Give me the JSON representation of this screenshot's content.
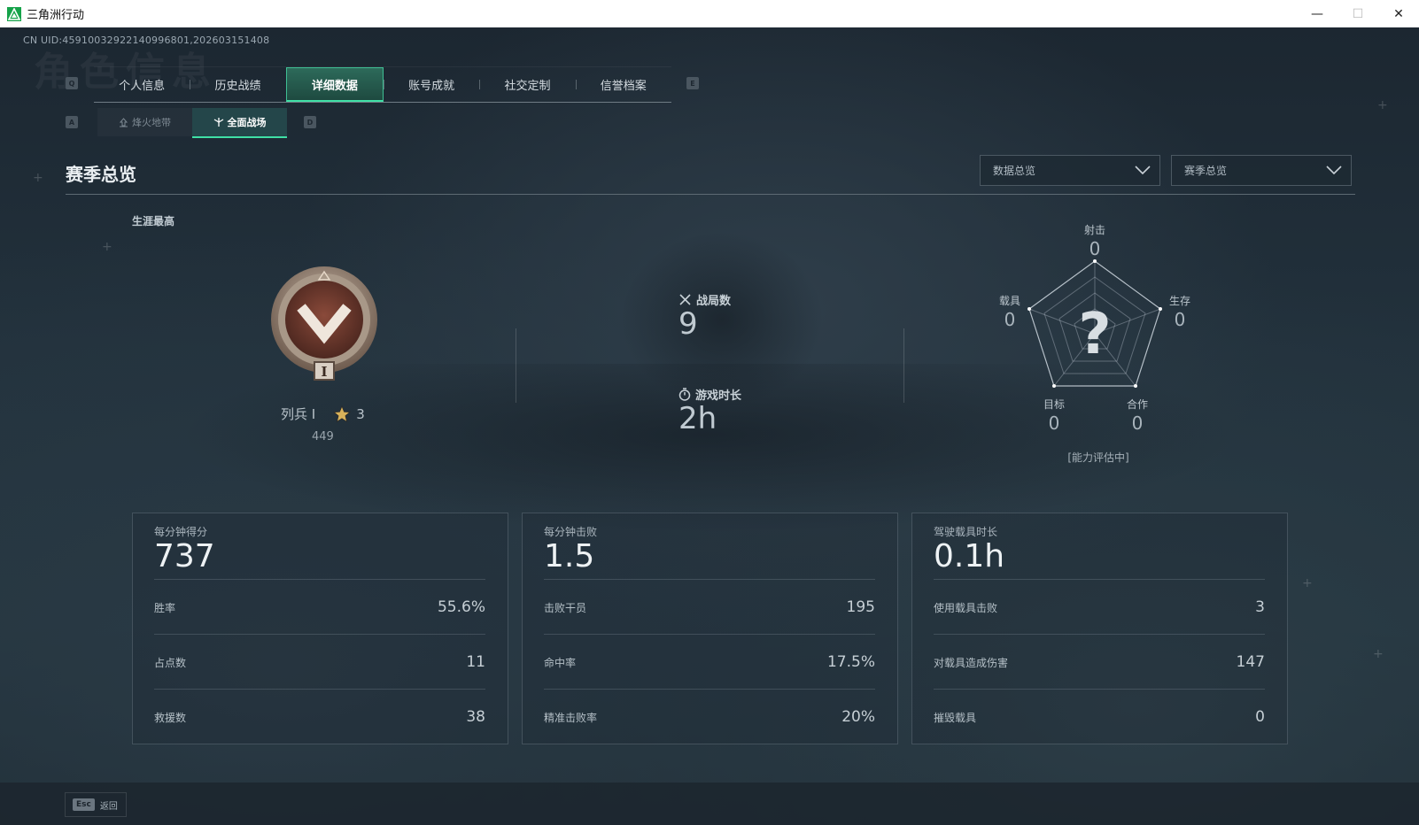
{
  "window": {
    "title": "三角洲行动",
    "minimize": "—",
    "maximize": "☐",
    "close": "✕"
  },
  "uid": "CN UID:4591003292214099680​1,202603151408",
  "watermark": "角色信息",
  "nav": {
    "key_left": "Q",
    "key_right": "E",
    "tabs": [
      "个人信息",
      "历史战绩",
      "详细数据",
      "账号成就",
      "社交定制",
      "信誉档案"
    ],
    "active_index": 2
  },
  "subnav": {
    "key_left": "A",
    "key_right": "D",
    "tabs": [
      "烽火地带",
      "全面战场"
    ],
    "active_index": 1
  },
  "section": {
    "title": "赛季总览",
    "dropdown_1": "数据总览",
    "dropdown_2": "赛季总览"
  },
  "career": {
    "label": "生涯最高",
    "rank_name": "列兵 I",
    "rank_numeral": "I",
    "stars": "3",
    "score": "449"
  },
  "summary": {
    "matches_label": "战局数",
    "matches_value": "9",
    "playtime_label": "游戏时长",
    "playtime_value": "2h"
  },
  "radar": {
    "unknown_mark": "?",
    "status": "[能力评估中]",
    "axes": [
      {
        "label": "射击",
        "value": "0"
      },
      {
        "label": "生存",
        "value": "0"
      },
      {
        "label": "合作",
        "value": "0"
      },
      {
        "label": "目标",
        "value": "0"
      },
      {
        "label": "载具",
        "value": "0"
      }
    ]
  },
  "cards": [
    {
      "head_label": "每分钟得分",
      "head_value": "737",
      "rows": [
        {
          "k": "胜率",
          "v": "55.6%"
        },
        {
          "k": "占点数",
          "v": "11"
        },
        {
          "k": "救援数",
          "v": "38"
        }
      ]
    },
    {
      "head_label": "每分钟击败",
      "head_value": "1.5",
      "rows": [
        {
          "k": "击败干员",
          "v": "195"
        },
        {
          "k": "命中率",
          "v": "17.5%"
        },
        {
          "k": "精准击败率",
          "v": "20%"
        }
      ]
    },
    {
      "head_label": "驾驶载具时长",
      "head_value": "0.1h",
      "rows": [
        {
          "k": "使用载具击败",
          "v": "3"
        },
        {
          "k": "对载具造成伤害",
          "v": "147"
        },
        {
          "k": "摧毁载具",
          "v": "0"
        }
      ]
    }
  ],
  "footer": {
    "esc_key": "Esc",
    "back_label": "返回"
  },
  "colors": {
    "accent": "#3fe0a6",
    "active_tab_bg": "#2d6a5a",
    "background": "#1d2a35"
  }
}
